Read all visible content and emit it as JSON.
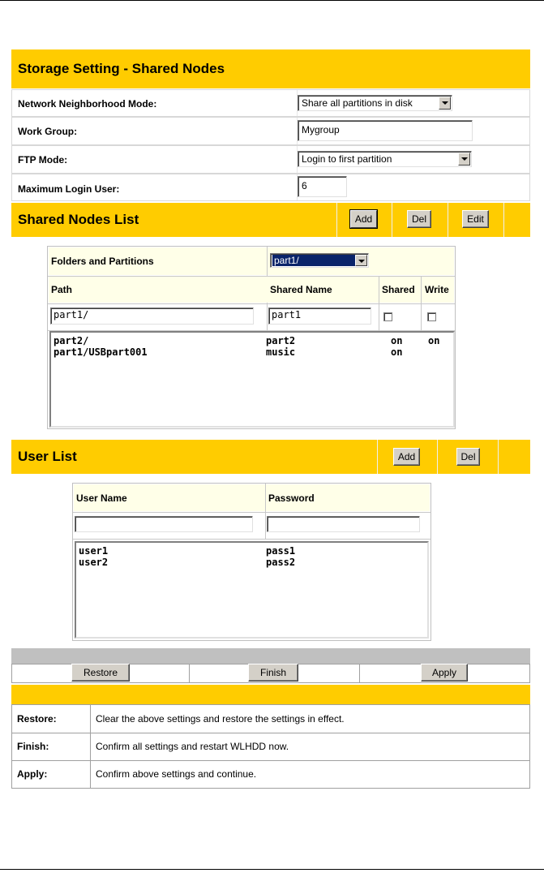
{
  "storage": {
    "title": "Storage Setting - Shared Nodes",
    "network_mode_label": "Network Neighborhood Mode:",
    "network_mode_value": "Share all partitions in disk",
    "work_group_label": "Work Group:",
    "work_group_value": "Mygroup",
    "ftp_mode_label": "FTP Mode:",
    "ftp_mode_value": "Login to first partition",
    "max_login_label": "Maximum Login User:",
    "max_login_value": "6"
  },
  "shared_nodes": {
    "title": "Shared Nodes List",
    "add_label": "Add",
    "del_label": "Del",
    "edit_label": "Edit",
    "folders_label": "Folders and Partitions",
    "folders_value": "part1/",
    "columns": {
      "path": "Path",
      "shared_name": "Shared Name",
      "shared": "Shared",
      "write": "Write"
    },
    "path_input": "part1/",
    "name_input": "part1",
    "rows": [
      {
        "path": "part2/",
        "name": "part2",
        "shared": "on",
        "write": "on"
      },
      {
        "path": "part1/USBpart001",
        "name": "music",
        "shared": "on",
        "write": ""
      }
    ]
  },
  "users": {
    "title": "User List",
    "add_label": "Add",
    "del_label": "Del",
    "columns": {
      "user_name": "User Name",
      "password": "Password"
    },
    "rows": [
      {
        "user": "user1",
        "password": "pass1"
      },
      {
        "user": "user2",
        "password": "pass2"
      }
    ]
  },
  "actions": {
    "restore_label": "Restore",
    "finish_label": "Finish",
    "apply_label": "Apply"
  },
  "help": [
    {
      "term": "Restore:",
      "text": "Clear the above settings and restore the settings in effect."
    },
    {
      "term": "Finish:",
      "text": "Confirm all settings and restart WLHDD now."
    },
    {
      "term": "Apply:",
      "text": "Confirm above settings and continue."
    }
  ],
  "colors": {
    "accent": "#ffcc00",
    "panel": "#ffffe8",
    "button": "#d4d0c8"
  }
}
